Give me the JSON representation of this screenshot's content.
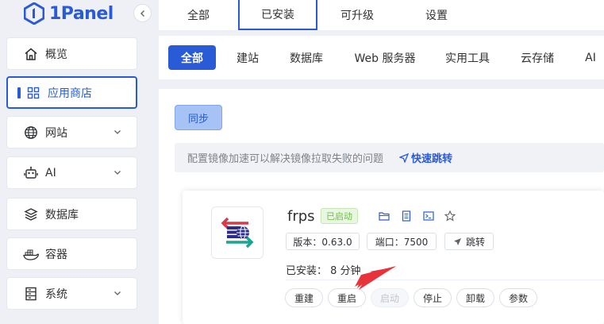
{
  "app": {
    "logo_text": "1Panel"
  },
  "sidebar": {
    "items": [
      {
        "label": "概览",
        "icon": "home-icon"
      },
      {
        "label": "应用商店",
        "icon": "grid-icon",
        "active": true
      },
      {
        "label": "网站",
        "icon": "globe-icon",
        "expandable": true
      },
      {
        "label": "AI",
        "icon": "robot-icon",
        "expandable": true
      },
      {
        "label": "数据库",
        "icon": "layers-icon"
      },
      {
        "label": "容器",
        "icon": "docker-icon"
      },
      {
        "label": "系统",
        "icon": "server-icon",
        "expandable": true
      }
    ]
  },
  "top_tabs": [
    "全部",
    "已安装",
    "可升级",
    "设置"
  ],
  "active_top_tab": "已安装",
  "categories": [
    "全部",
    "建站",
    "数据库",
    "Web 服务器",
    "实用工具",
    "云存储",
    "AI"
  ],
  "active_category": "全部",
  "sync_label": "同步",
  "notice": {
    "text": "配置镜像加速可以解决镜像拉取失败的问题",
    "link": "快速跳转"
  },
  "app_card": {
    "name": "frps",
    "status": "已启动",
    "version_label": "版本：0.63.0",
    "port_label": "端口：7500",
    "jump_label": "跳转",
    "installed_label": "已安装：",
    "installed_value": "8 分钟",
    "actions": [
      {
        "label": "重建",
        "disabled": false
      },
      {
        "label": "重启",
        "disabled": false
      },
      {
        "label": "启动",
        "disabled": true
      },
      {
        "label": "停止",
        "disabled": false
      },
      {
        "label": "卸载",
        "disabled": false
      },
      {
        "label": "参数",
        "disabled": false
      }
    ]
  },
  "colors": {
    "primary": "#2a5bd7",
    "success": "#67c23a",
    "annotation_arrow": "#e8333a"
  }
}
